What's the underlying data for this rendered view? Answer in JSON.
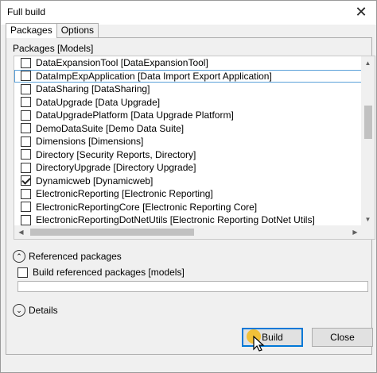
{
  "window": {
    "title": "Full build"
  },
  "tabs": [
    {
      "label": "Packages",
      "active": true
    },
    {
      "label": "Options",
      "active": false
    }
  ],
  "packages": {
    "group_label": "Packages [Models]",
    "items": [
      {
        "label": "DataExpansionTool [DataExpansionTool]",
        "checked": false
      },
      {
        "label": "DataImpExpApplication [Data Import Export Application]",
        "checked": false,
        "selected": true
      },
      {
        "label": "DataSharing [DataSharing]",
        "checked": false
      },
      {
        "label": "DataUpgrade [Data Upgrade]",
        "checked": false
      },
      {
        "label": "DataUpgradePlatform [Data Upgrade Platform]",
        "checked": false
      },
      {
        "label": "DemoDataSuite [Demo Data Suite]",
        "checked": false
      },
      {
        "label": "Dimensions [Dimensions]",
        "checked": false
      },
      {
        "label": "Directory [Security Reports, Directory]",
        "checked": false
      },
      {
        "label": "DirectoryUpgrade [Directory Upgrade]",
        "checked": false
      },
      {
        "label": "Dynamicweb [Dynamicweb]",
        "checked": true
      },
      {
        "label": "ElectronicReporting [Electronic Reporting]",
        "checked": false
      },
      {
        "label": "ElectronicReportingCore [Electronic Reporting Core]",
        "checked": false
      },
      {
        "label": "ElectronicReportingDotNetUtils [Electronic Reporting DotNet Utils]",
        "checked": false
      }
    ]
  },
  "referenced": {
    "expander_label": "Referenced packages",
    "checkbox_label": "Build referenced packages [models]",
    "checkbox_checked": false,
    "textbox_value": ""
  },
  "details": {
    "expander_label": "Details"
  },
  "buttons": {
    "build": "Build",
    "close": "Close"
  },
  "icons": {
    "close": "close-icon",
    "expand_up": "chevron-up-icon",
    "expand_down": "chevron-down-icon",
    "checkmark": "check-icon",
    "cursor": "mouse-pointer-icon"
  },
  "colors": {
    "accent": "#0078d7",
    "selection_outline": "#5aa0d8",
    "click_highlight": "#f5b400"
  }
}
